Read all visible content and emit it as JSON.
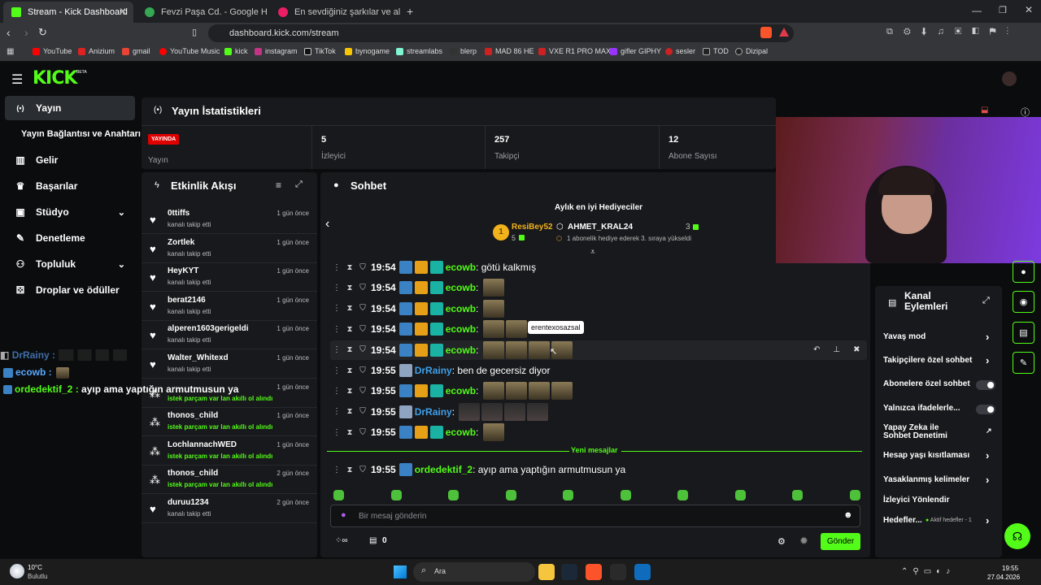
{
  "browser": {
    "tabs": [
      {
        "title": "Stream - Kick Dashboard",
        "active": true
      },
      {
        "title": "Fevzi Paşa Cd. - Google Haritalar",
        "active": false
      },
      {
        "title": "En sevdiğiniz şarkılar ve albümleri din",
        "active": false
      }
    ],
    "url": "dashboard.kick.com/stream",
    "bookmarks": [
      "YouTube",
      "Anizium",
      "gmail",
      "YouTube Music",
      "kick",
      "instagram",
      "TikTok",
      "bynogame",
      "streamlabs",
      "blerp",
      "MAD 86 HE",
      "VXE R1 PRO MAX",
      "gifler GIPHY",
      "sesler",
      "TOD",
      "Dizipal"
    ]
  },
  "app": {
    "logo": "KICK",
    "logo_sup": "BETA",
    "nav": [
      {
        "label": "Yayın",
        "icon": "broadcast-icon",
        "glyph": "(•)"
      },
      {
        "label": "Yayın Bağlantısı ve Anahtarı",
        "icon": "",
        "glyph": ""
      },
      {
        "label": "Gelir",
        "icon": "chart-icon",
        "glyph": "▥"
      },
      {
        "label": "Başarılar",
        "icon": "trophy-icon",
        "glyph": "🏆"
      },
      {
        "label": "Stüdyo",
        "icon": "video-icon",
        "glyph": "▶"
      },
      {
        "label": "Denetleme",
        "icon": "wrench-icon",
        "glyph": "🔧"
      },
      {
        "label": "Topluluk",
        "icon": "people-icon",
        "glyph": "👥"
      },
      {
        "label": "Droplar ve ödüller",
        "icon": "gift-icon",
        "glyph": "🎁"
      }
    ]
  },
  "stats": {
    "title": "Yayın İstatistikleri",
    "live_badge": "YAYINDA",
    "live_label": "Yayın",
    "items": [
      {
        "value": "5",
        "label": "İzleyici"
      },
      {
        "value": "257",
        "label": "Takipçi"
      },
      {
        "value": "12",
        "label": "Abone Sayısı"
      }
    ]
  },
  "activity": {
    "title": "Etkinlik Akışı",
    "events": [
      {
        "name": "0ttiffs",
        "action": "kanalı takip etti",
        "time": "1 gün önce",
        "kind": "follow"
      },
      {
        "name": "Zortlek",
        "action": "kanalı takip etti",
        "time": "1 gün önce",
        "kind": "follow"
      },
      {
        "name": "HeyKYT",
        "action": "kanalı takip etti",
        "time": "1 gün önce",
        "kind": "follow"
      },
      {
        "name": "berat2146",
        "action": "kanalı takip etti",
        "time": "1 gün önce",
        "kind": "follow"
      },
      {
        "name": "alperen1603gerigeldi",
        "action": "kanalı takip etti",
        "time": "1 gün önce",
        "kind": "follow"
      },
      {
        "name": "Walter_Whitexd",
        "action": "kanalı takip etti",
        "time": "1 gün önce",
        "kind": "follow"
      },
      {
        "name": "",
        "action": "istek parçam var lan akıllı ol alındı",
        "time": "1 gün önce",
        "kind": "reward"
      },
      {
        "name": "thonos_child",
        "action": "istek parçam var lan akıllı ol alındı",
        "time": "1 gün önce",
        "kind": "reward"
      },
      {
        "name": "LochlannachWED",
        "action": "istek parçam var lan akıllı ol alındı",
        "time": "1 gün önce",
        "kind": "reward"
      },
      {
        "name": "thonos_child",
        "action": "istek parçam var lan akıllı ol alındı",
        "time": "2 gün önce",
        "kind": "reward"
      },
      {
        "name": "duruu1234",
        "action": "kanalı takip etti",
        "time": "2 gün önce",
        "kind": "follow"
      }
    ]
  },
  "chat": {
    "title": "Sohbet",
    "gifters_title": "Aylık en iyi Hediyeciler",
    "gifter1": {
      "rank": "1",
      "name": "ResiBey52",
      "count": "5"
    },
    "gifter2": {
      "name": "AHMET_KRAL24",
      "count": "3",
      "note": "1 abonelik hediye ederek 3. sıraya yükseldi"
    },
    "tooltip": "erentexosazsal",
    "messages": [
      {
        "time": "19:54",
        "user": "ecowb",
        "color": "#53fc18",
        "badges": 3,
        "text": "götü kalkmış",
        "emotes": 0
      },
      {
        "time": "19:54",
        "user": "ecowb",
        "color": "#53fc18",
        "badges": 3,
        "text": "",
        "emotes": 1
      },
      {
        "time": "19:54",
        "user": "ecowb",
        "color": "#53fc18",
        "badges": 3,
        "text": "",
        "emotes": 1
      },
      {
        "time": "19:54",
        "user": "ecowb",
        "color": "#53fc18",
        "badges": 3,
        "text": "",
        "emotes": 2
      },
      {
        "time": "19:54",
        "user": "ecowb",
        "color": "#53fc18",
        "badges": 3,
        "text": "",
        "emotes": 4
      },
      {
        "time": "19:55",
        "user": "DrRainy",
        "color": "#3fa0e8",
        "badges": 1,
        "text": "ben de gecersiz diyor",
        "emotes": 0
      },
      {
        "time": "19:55",
        "user": "ecowb",
        "color": "#53fc18",
        "badges": 3,
        "text": "",
        "emotes": 4
      },
      {
        "time": "19:55",
        "user": "DrRainy",
        "color": "#3fa0e8",
        "badges": 1,
        "text": "",
        "emotes": 4
      },
      {
        "time": "19:55",
        "user": "ecowb",
        "color": "#53fc18",
        "badges": 3,
        "text": "",
        "emotes": 1
      }
    ],
    "new_messages": "Yeni mesajlar",
    "new_message": {
      "time": "19:55",
      "user": "ordedektif_2",
      "color": "#53fc18",
      "text": "ayıp ama yaptığın armutmusun ya"
    },
    "input_placeholder": "Bir mesaj gönderin",
    "points": "0",
    "send_label": "Gönder"
  },
  "overlay_chat": [
    {
      "user": "DrRainy",
      "text": ""
    },
    {
      "user": "ecowb",
      "text": ""
    },
    {
      "user": "ordedektif_2",
      "text": "ayıp ama yaptığın armutmusun ya"
    }
  ],
  "channel_actions": {
    "title": "Kanal Eylemleri",
    "items": [
      {
        "label": "Yavaş mod",
        "control": "chevron"
      },
      {
        "label": "Takipçilere özel sohbet",
        "control": "chevron"
      },
      {
        "label": "Abonelere özel sohbet",
        "control": "toggle"
      },
      {
        "label": "Yalnızca ifadelerle...",
        "control": "toggle"
      },
      {
        "label": "Yapay Zeka ile Sohbet Denetimi",
        "control": "external"
      },
      {
        "label": "Hesap yaşı kısıtlaması",
        "control": "chevron"
      },
      {
        "label": "Yasaklanmış kelimeler",
        "control": "chevron"
      },
      {
        "label": "İzleyici Yönlendir",
        "control": "none"
      },
      {
        "label": "Hedefler...",
        "control": "chevron"
      }
    ],
    "goal_status": "Aktif hedefler - 1"
  },
  "taskbar": {
    "weather_temp": "10°C",
    "weather_desc": "Bulutlu",
    "search": "Ara",
    "time": "19:55",
    "date": "27.04.2026"
  }
}
